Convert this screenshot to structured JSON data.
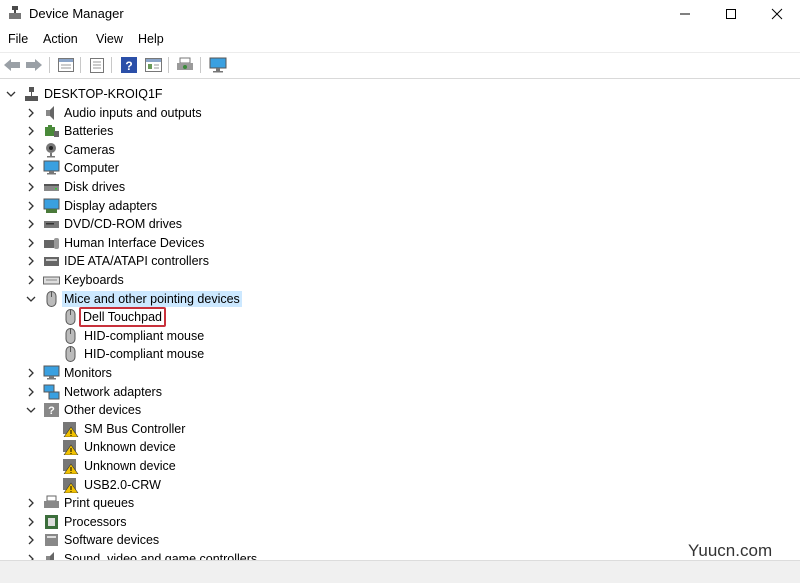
{
  "window": {
    "title": "Device Manager"
  },
  "menu": [
    "File",
    "Action",
    "View",
    "Help"
  ],
  "tree": {
    "root": "DESKTOP-KROIQ1F",
    "categories": [
      "Audio inputs and outputs",
      "Batteries",
      "Cameras",
      "Computer",
      "Disk drives",
      "Display adapters",
      "DVD/CD-ROM drives",
      "Human Interface Devices",
      "IDE ATA/ATAPI controllers",
      "Keyboards",
      "Mice and other pointing devices",
      "Dell Touchpad",
      "HID-compliant mouse",
      "HID-compliant mouse",
      "Monitors",
      "Network adapters",
      "Other devices",
      "SM Bus Controller",
      "Unknown device",
      "Unknown device",
      "USB2.0-CRW",
      "Print queues",
      "Processors",
      "Software devices",
      "Sound, video and game controllers"
    ]
  },
  "watermark": "Yuucn.com",
  "colors": {
    "selection": "#cce8ff",
    "highlight_box": "#c8313b"
  }
}
